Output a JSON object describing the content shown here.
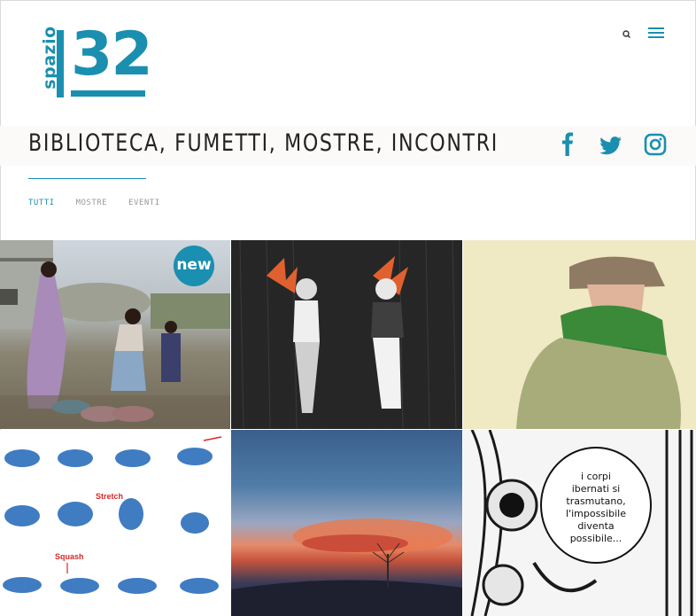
{
  "logo": {
    "word": "spazio",
    "number": "32"
  },
  "header": {
    "tagline": "BIBLIOTECA, FUMETTI, MOSTRE, INCONTRI"
  },
  "filters": [
    {
      "label": "TUTTI",
      "active": true
    },
    {
      "label": "MOSTRE",
      "active": false
    },
    {
      "label": "EVENTI",
      "active": false
    }
  ],
  "grid": {
    "badge": "new",
    "annotations": {
      "stretch": "Stretch",
      "squash": "Squash",
      "speech": [
        "i corpi",
        "ibernati si",
        "trasmutano,",
        "l'impossibile",
        "diventa",
        "possibile..."
      ]
    }
  },
  "colors": {
    "accent": "#1a8fb0",
    "text": "#222222",
    "muted": "#999999"
  },
  "icons": [
    "search-icon",
    "menu-icon",
    "facebook-icon",
    "twitter-icon",
    "instagram-icon"
  ]
}
